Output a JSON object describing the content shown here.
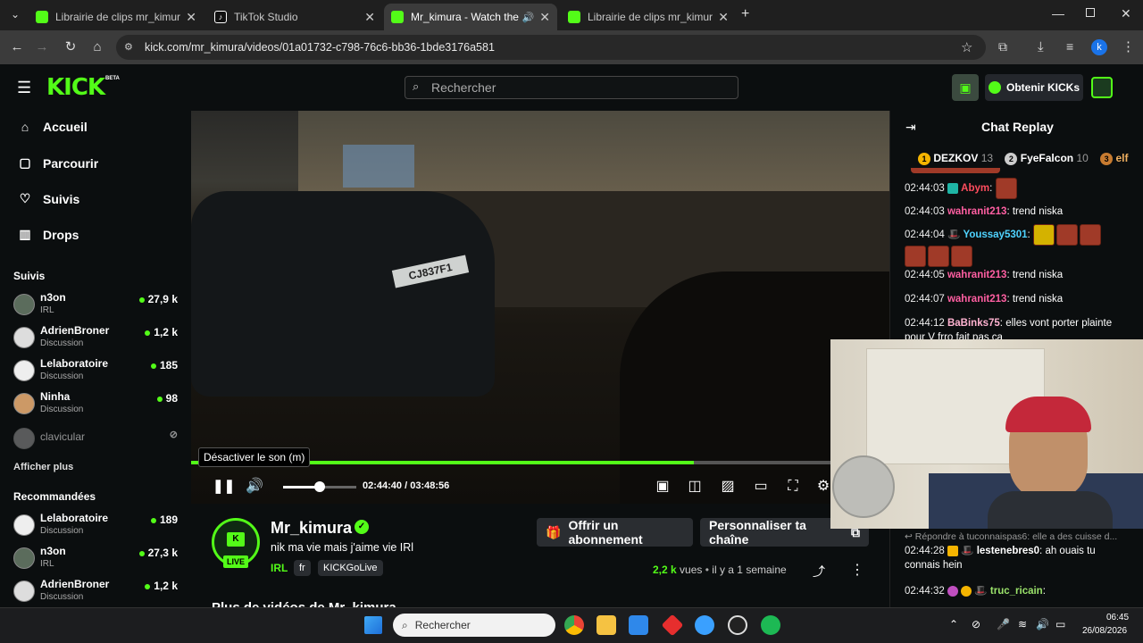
{
  "browser": {
    "tabs": [
      {
        "title": "Librairie de clips mr_kimura | Cl",
        "active": false
      },
      {
        "title": "TikTok Studio",
        "active": false
      },
      {
        "title": "Mr_kimura - Watch the VOD",
        "active": true
      },
      {
        "title": "Librairie de clips mr_kimura | Cl",
        "active": false
      }
    ],
    "url": "kick.com/mr_kimura/videos/01a01732-c798-76c6-bb36-1bde3176a581",
    "profile_initial": "k"
  },
  "header": {
    "logo": "KICK",
    "logo_badge": "BETA",
    "search_placeholder": "Rechercher",
    "kicks_button": "Obtenir KICKs"
  },
  "sidebar": {
    "main": [
      {
        "label": "Accueil",
        "icon": "home-icon"
      },
      {
        "label": "Parcourir",
        "icon": "browse-icon"
      },
      {
        "label": "Suivis",
        "icon": "heart-icon"
      },
      {
        "label": "Drops",
        "icon": "drops-icon"
      }
    ],
    "following_title": "Suivis",
    "following": [
      {
        "name": "n3on",
        "category": "IRL",
        "viewers": "27,9 k"
      },
      {
        "name": "AdrienBroner",
        "category": "Discussion",
        "viewers": "1,2 k"
      },
      {
        "name": "Lelaboratoire",
        "category": "Discussion",
        "viewers": "185"
      },
      {
        "name": "Ninha",
        "category": "Discussion",
        "viewers": "98"
      },
      {
        "name": "clavicular",
        "category": "",
        "viewers": ""
      }
    ],
    "show_more": "Afficher plus",
    "recommended_title": "Recommandées",
    "recommended": [
      {
        "name": "Lelaboratoire",
        "category": "Discussion",
        "viewers": "189"
      },
      {
        "name": "n3on",
        "category": "IRL",
        "viewers": "27,3 k"
      },
      {
        "name": "AdrienBroner",
        "category": "Discussion",
        "viewers": "1,2 k"
      }
    ]
  },
  "player": {
    "tooltip": "Désactiver le son (m)",
    "current_time": "02:44:40",
    "separator": "/",
    "duration": "03:48:56",
    "progress": 0.72,
    "volume": 0.5,
    "plate": "CJ837F1"
  },
  "channel": {
    "name": "Mr_kimura",
    "live_badge": "LIVE",
    "description": "nik ma vie mais j'aime vie IRl",
    "category": "IRL",
    "tags": [
      "fr",
      "KICKGoLive"
    ],
    "subscribe_button": "Offrir un abonnement",
    "customize_button": "Personnaliser ta chaîne",
    "views": "2,2 k",
    "views_label": "vues",
    "ago": "il y a 1 semaine",
    "more_videos": "Plus de vidéos de Mr_kimura"
  },
  "chat": {
    "title": "Chat Replay",
    "leaderboard": [
      {
        "rank": "1",
        "name": "DEZKOV",
        "count": "13"
      },
      {
        "rank": "2",
        "name": "FyeFalcon",
        "count": "10"
      },
      {
        "rank": "3",
        "name": "elf",
        "count": ""
      }
    ],
    "messages": [
      {
        "time": "02:44:03",
        "user": "Abym",
        "text": "",
        "color": "#ff4d5e"
      },
      {
        "time": "02:44:03",
        "user": "wahranit213",
        "text": "trend niska",
        "color": "#ff5fa2"
      },
      {
        "time": "02:44:04",
        "user": "Youssay5301",
        "text": "",
        "color": "#4fd3ff"
      },
      {
        "time": "02:44:05",
        "user": "wahranit213",
        "text": "trend niska",
        "color": "#ff5fa2"
      },
      {
        "time": "02:44:07",
        "user": "wahranit213",
        "text": "trend niska",
        "color": "#ff5fa2"
      },
      {
        "time": "02:44:12",
        "user": "BaBinks75",
        "text": "elles vont porter plainte pour V frro fait pas ça",
        "color": "#ffb3d1"
      }
    ],
    "reply_note": "Répondre à tuconnaispas6: elle a des cuisse d...",
    "late_messages": [
      {
        "time": "02:44:28",
        "user": "lestenebres0",
        "text": "ah ouais tu connais hein",
        "color": "#ffffff"
      },
      {
        "time": "02:44:32",
        "user": "truc_ricain",
        "text": "",
        "color": "#9be36b"
      }
    ]
  },
  "taskbar": {
    "search_placeholder": "Rechercher",
    "time": "06:45",
    "date": "26/08/2026"
  }
}
